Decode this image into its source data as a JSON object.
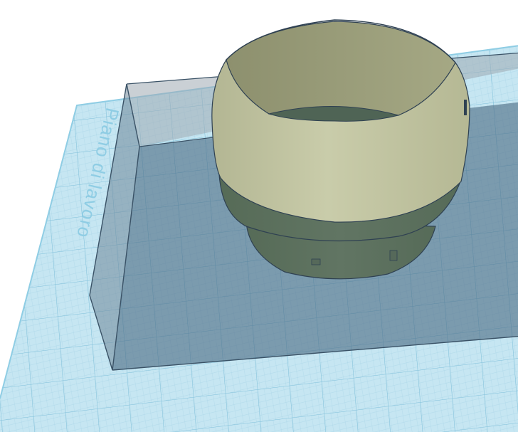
{
  "workplane": {
    "label": "Piano di lavoro"
  },
  "colors": {
    "background": "#ffffff",
    "workplane_fill": "#c6e6f2",
    "grid_minor": "#a6d3e6",
    "grid_major": "#7fbfd9",
    "workplane_label": "#8fcde4",
    "hole_box_fill": "#5f7f95",
    "hole_box_edge": "#3a5266",
    "object_top": "#c3c6a2",
    "object_inner": "#9fa27f",
    "object_shadowed": "#5f7460",
    "object_edge": "#2f4152"
  },
  "objects": [
    {
      "name": "hole-box",
      "kind": "hole"
    },
    {
      "name": "cylindrical-ring",
      "kind": "solid"
    }
  ]
}
